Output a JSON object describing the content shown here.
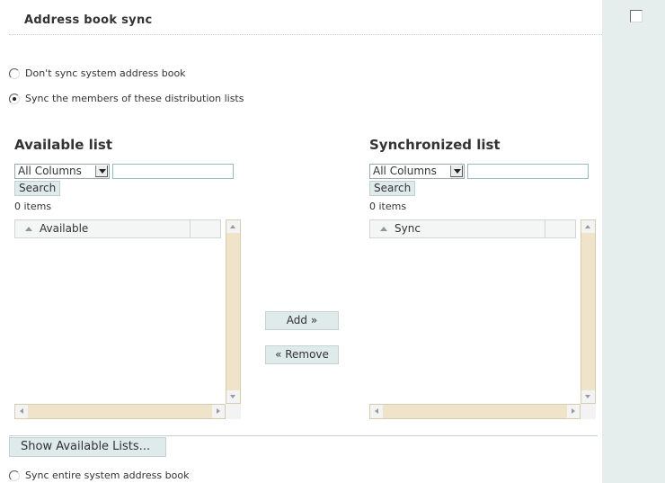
{
  "section": {
    "title": "Address book sync"
  },
  "options": {
    "dont_sync": "Don't sync system address book",
    "sync_members": "Sync the members of these distribution lists",
    "sync_entire": "Sync entire system address book",
    "selected": "sync_members"
  },
  "available": {
    "title": "Available list",
    "column_select": "All Columns",
    "search_value": "",
    "search_button": "Search",
    "count": "0 items",
    "column_header": "Available"
  },
  "synchronized": {
    "title": "Synchronized list",
    "column_select": "All Columns",
    "search_value": "",
    "search_button": "Search",
    "count": "0 items",
    "column_header": "Sync"
  },
  "actions": {
    "add": "Add »",
    "remove": "« Remove"
  },
  "footer": {
    "show_lists_button": "Show Available Lists..."
  },
  "colors": {
    "button_bg": "#dfeaea",
    "scrollbar": "#efe4c9",
    "side_pane": "#e6eded"
  }
}
